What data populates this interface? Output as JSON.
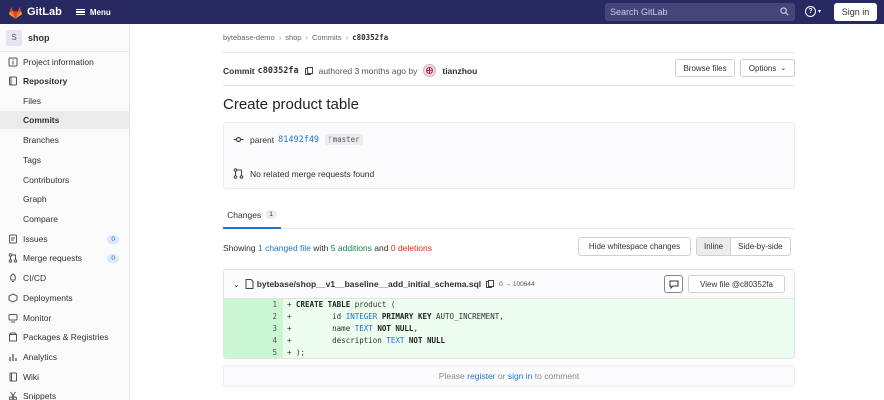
{
  "topbar": {
    "brand": "GitLab",
    "menu_label": "Menu",
    "search_placeholder": "Search GitLab",
    "help_caret": "▾",
    "signin_label": "Sign in"
  },
  "sidebar": {
    "project_initial": "S",
    "project_name": "shop",
    "items": [
      {
        "label": "Project information",
        "icon": "info-icon"
      },
      {
        "label": "Repository",
        "icon": "repository-icon"
      },
      {
        "label": "Files"
      },
      {
        "label": "Commits"
      },
      {
        "label": "Branches"
      },
      {
        "label": "Tags"
      },
      {
        "label": "Contributors"
      },
      {
        "label": "Graph"
      },
      {
        "label": "Compare"
      },
      {
        "label": "Issues",
        "icon": "issues-icon",
        "badge": "0"
      },
      {
        "label": "Merge requests",
        "icon": "merge-request-icon",
        "badge": "0"
      },
      {
        "label": "CI/CD",
        "icon": "rocket-icon"
      },
      {
        "label": "Deployments",
        "icon": "deployments-icon"
      },
      {
        "label": "Monitor",
        "icon": "monitor-icon"
      },
      {
        "label": "Packages & Registries",
        "icon": "package-icon"
      },
      {
        "label": "Analytics",
        "icon": "chart-icon"
      },
      {
        "label": "Wiki",
        "icon": "book-icon"
      },
      {
        "label": "Snippets",
        "icon": "snippet-icon"
      }
    ]
  },
  "breadcrumb": [
    "bytebase-demo",
    "shop",
    "Commits",
    "c80352fa"
  ],
  "commit": {
    "prefix": "Commit",
    "sha": "c80352fa",
    "authored": "authored 3 months ago by",
    "author": "tianzhou",
    "browse_label": "Browse files",
    "options_label": "Options",
    "title": "Create product table",
    "parent_label": "parent",
    "parent_sha": "81492f49",
    "branch": "master",
    "no_mr": "No related merge requests found"
  },
  "changes": {
    "tab_label": "Changes",
    "tab_count": "1",
    "showing": "Showing",
    "changed_files": "1 changed file",
    "with": "with",
    "additions": "5 additions",
    "and": "and",
    "deletions": "0 deletions",
    "hide_ws": "Hide whitespace changes",
    "inline": "Inline",
    "side_by_side": "Side-by-side"
  },
  "file": {
    "chevron": "⌄",
    "path": "bytebase/shop__v1__baseline__add_initial_schema.sql",
    "mode": "0 → 100644",
    "view_file": "View file @c80352fa",
    "lines": [
      {
        "n": "1",
        "sign": "+",
        "tokens": [
          [
            "kw",
            "CREATE"
          ],
          [
            "t",
            " "
          ],
          [
            "kw",
            "TABLE"
          ],
          [
            "t",
            " product ("
          ]
        ]
      },
      {
        "n": "2",
        "sign": "+",
        "tokens": [
          [
            "t",
            "        id "
          ],
          [
            "ty",
            "INTEGER"
          ],
          [
            "t",
            " "
          ],
          [
            "kw",
            "PRIMARY"
          ],
          [
            "t",
            " "
          ],
          [
            "kw",
            "KEY"
          ],
          [
            "t",
            " AUTO_INCREMENT,"
          ]
        ]
      },
      {
        "n": "3",
        "sign": "+",
        "tokens": [
          [
            "t",
            "        name "
          ],
          [
            "ty",
            "TEXT"
          ],
          [
            "t",
            " "
          ],
          [
            "kw",
            "NOT"
          ],
          [
            "t",
            " "
          ],
          [
            "kw",
            "NULL"
          ],
          [
            "t",
            ","
          ]
        ]
      },
      {
        "n": "4",
        "sign": "+",
        "tokens": [
          [
            "t",
            "        description "
          ],
          [
            "ty",
            "TEXT"
          ],
          [
            "t",
            " "
          ],
          [
            "kw",
            "NOT"
          ],
          [
            "t",
            " "
          ],
          [
            "kw",
            "NULL"
          ]
        ]
      },
      {
        "n": "5",
        "sign": "+",
        "tokens": [
          [
            "t",
            ");"
          ]
        ]
      }
    ]
  },
  "comment_bar": {
    "please": "Please",
    "register": "register",
    "or": "or",
    "signin": "sign in",
    "to_comment": "to comment"
  }
}
